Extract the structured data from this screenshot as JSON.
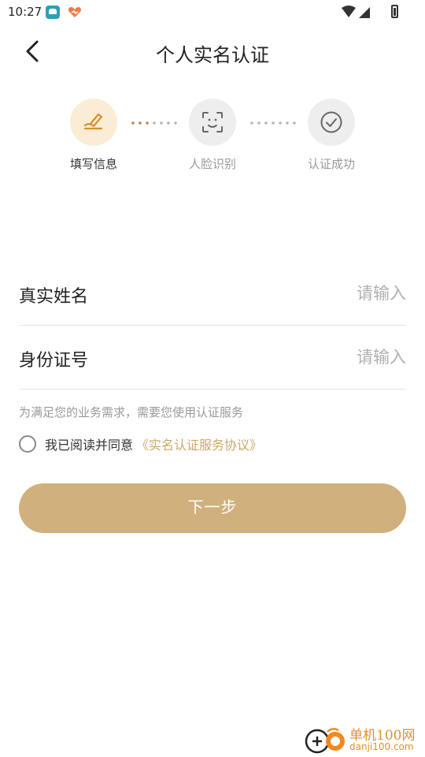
{
  "status_bar": {
    "time": "10:27"
  },
  "header": {
    "title": "个人实名认证"
  },
  "steps": [
    {
      "label": "填写信息",
      "icon": "pen-sign-icon",
      "active": true
    },
    {
      "label": "人脸识别",
      "icon": "face-scan-icon",
      "active": false
    },
    {
      "label": "认证成功",
      "icon": "check-circle-icon",
      "active": false
    }
  ],
  "form": {
    "name_label": "真实姓名",
    "name_placeholder": "请输入",
    "name_value": "",
    "id_label": "身份证号",
    "id_placeholder": "请输入",
    "id_value": ""
  },
  "notice": "为满足您的业务需求，需要您使用认证服务",
  "agreement": {
    "checked": false,
    "text": "我已阅读并同意",
    "link": "《实名认证服务协议》"
  },
  "next_button": "下一步",
  "watermark": {
    "name": "单机100网",
    "domain": "danji100.com"
  },
  "colors": {
    "accent": "#d0b07c",
    "link": "#c9a86c",
    "active_step_bg": "#fbecd6",
    "inactive_step_bg": "#eeeeee",
    "active_dot": "#b88a3a",
    "inactive_dot": "#b5b5b5"
  }
}
